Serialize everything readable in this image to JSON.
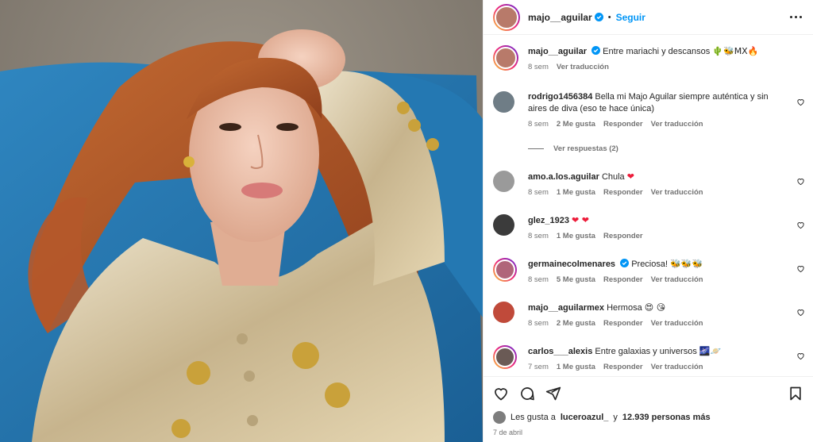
{
  "header": {
    "username": "majo__aguilar",
    "separator": "•",
    "follow_label": "Seguir"
  },
  "caption": {
    "username": "majo__aguilar",
    "text": "Entre mariachi y descansos",
    "emoji": "🌵🐝MX🔥",
    "time": "8 sem",
    "translate": "Ver traducción"
  },
  "comments": [
    {
      "username": "rodrigo1456384",
      "text": "Bella mi Majo Aguilar siempre auténtica y sin aires de diva (eso te hace única)",
      "time": "8 sem",
      "likes": "2 Me gusta",
      "reply": "Responder",
      "translate": "Ver traducción",
      "verified": false,
      "avatar_color": "#6f7d86"
    },
    {
      "username": "amo.a.los.aguilar",
      "text": "Chula",
      "emoji": "❤",
      "time": "8 sem",
      "likes": "1 Me gusta",
      "reply": "Responder",
      "translate": "Ver traducción",
      "verified": false,
      "avatar_color": "#9a9a9a"
    },
    {
      "username": "glez_1923",
      "text": "",
      "emoji": "❤ ❤",
      "time": "8 sem",
      "likes": "1 Me gusta",
      "reply": "Responder",
      "translate": "",
      "verified": false,
      "avatar_color": "#3b3b3b"
    },
    {
      "username": "germainecolmenares",
      "text": "Preciosa!",
      "emoji": "🐝🐝🐝",
      "time": "8 sem",
      "likes": "5 Me gusta",
      "reply": "Responder",
      "translate": "Ver traducción",
      "verified": true,
      "avatar_color": "#b0657a"
    },
    {
      "username": "majo__aguilarmex",
      "text": "Hermosa",
      "emoji": "😍 😘",
      "time": "8 sem",
      "likes": "2 Me gusta",
      "reply": "Responder",
      "translate": "Ver traducción",
      "verified": false,
      "avatar_color": "#c04a3a"
    },
    {
      "username": "carlos___alexis",
      "text": "Entre galaxias y universos",
      "emoji": "🌌🪐",
      "time": "7 sem",
      "likes": "1 Me gusta",
      "reply": "Responder",
      "translate": "Ver traducción",
      "verified": false,
      "avatar_color": "#6a5a55"
    }
  ],
  "replies_label": "Ver respuestas (2)",
  "likes": {
    "prefix": "Les gusta a",
    "user": "luceroazul_",
    "middle": "y",
    "count": "12.939 personas más"
  },
  "date": "7 de abril",
  "colors": {
    "accent": "#0095f6",
    "heart": "#ed1c3a",
    "verified": "#0095f6"
  },
  "icons": [
    "heart-icon",
    "comment-icon",
    "share-icon",
    "save-icon",
    "more-icon",
    "verified-icon"
  ]
}
